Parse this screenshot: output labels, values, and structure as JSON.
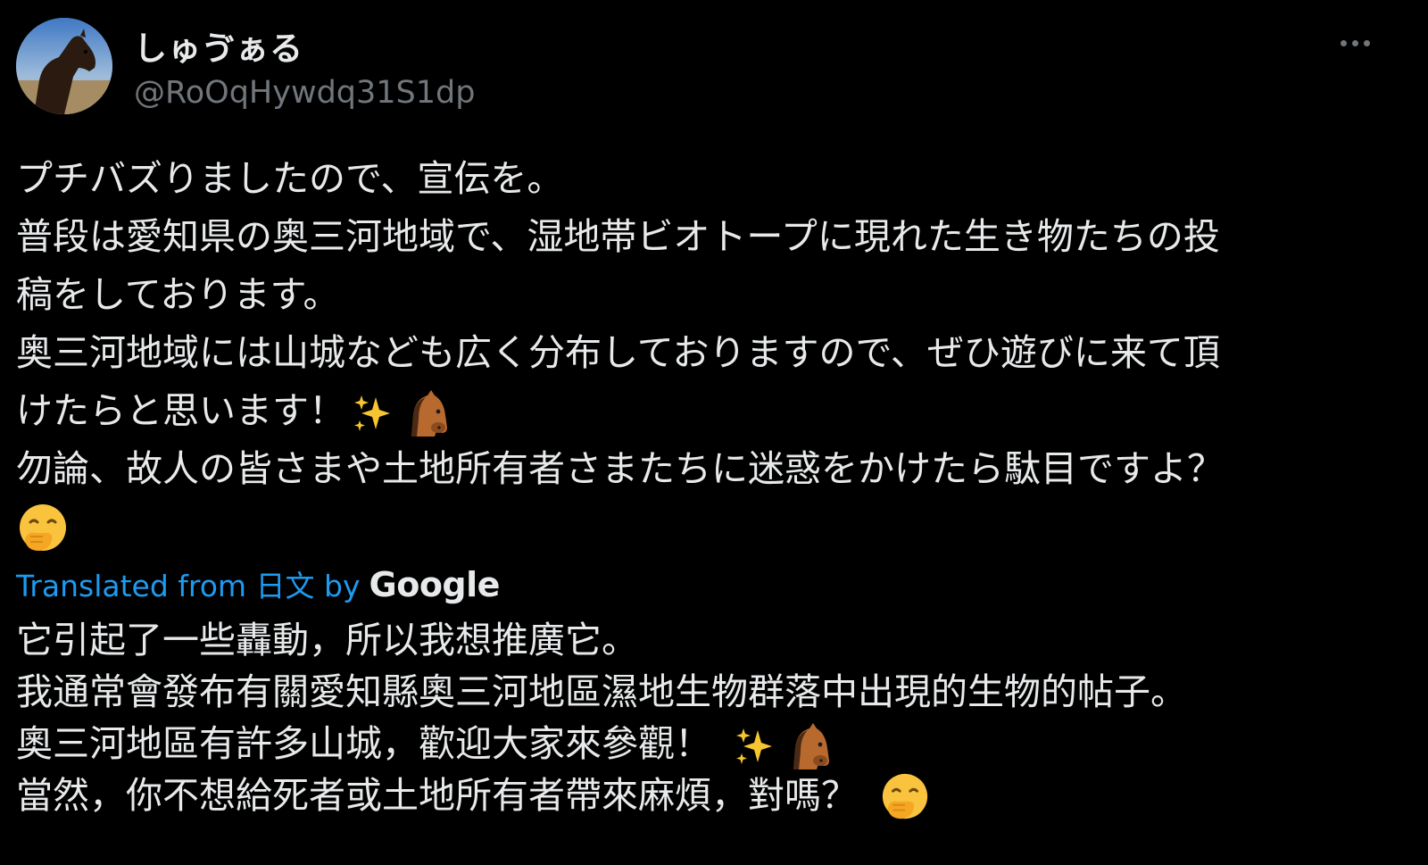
{
  "author": {
    "display_name": "しゅゔぁる",
    "handle": "@RoOqHywdq31S1dp",
    "avatar_icon": "horse-photo-avatar"
  },
  "actions": {
    "more_icon": "ellipsis-icon"
  },
  "post": {
    "lines": [
      "プチバズりましたので、宣伝を。",
      "普段は愛知県の奥三河地域で、湿地帯ビオトープに現れた生き物たちの投",
      "稿をしております。",
      "奥三河地域には山城なども広く分布しておりますので、ぜひ遊びに来て頂",
      "けたらと思います！",
      "勿論、故人の皆さまや土地所有者さまたちに迷惑をかけたら駄目ですよ？"
    ],
    "emojis": [
      "sparkles-emoji",
      "horse-face-emoji",
      "hand-over-mouth-emoji"
    ]
  },
  "translation": {
    "label": "Translated from 日文 by",
    "provider": "Google",
    "lines": [
      "它引起了一些轟動，所以我想推廣它。",
      "我通常會發布有關愛知縣奧三河地區濕地生物群落中出現的生物的帖子。",
      "奧三河地區有許多山城，歡迎大家來參觀！",
      "當然，你不想給死者或土地所有者帶來麻煩，對嗎？"
    ]
  },
  "colors": {
    "background": "#000000",
    "text": "#e7e9ea",
    "secondary": "#71767b",
    "link": "#1d9bf0"
  }
}
